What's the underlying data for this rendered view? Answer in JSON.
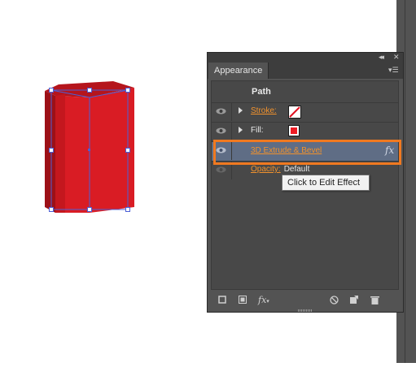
{
  "panel": {
    "tab_label": "Appearance",
    "object_label": "Path",
    "rows": {
      "stroke_label": "Stroke:",
      "fill_label": "Fill:",
      "effect_label": "3D Extrude & Bevel",
      "opacity_label": "Opacity:",
      "opacity_value": "Default"
    },
    "fill_color": "#ee1c24"
  },
  "tooltip": {
    "text": "Click to Edit Effect"
  },
  "colors": {
    "highlight": "#f07920",
    "panel_bg": "#535353",
    "selected_row": "#5f6d85",
    "link": "#f1922d",
    "box_front": "#d91c24",
    "box_side": "#9c1017",
    "selection": "#4b5fd6"
  },
  "icons": {
    "fx": "fx",
    "new_layer": "new-layer-icon",
    "delete": "trash-icon"
  }
}
